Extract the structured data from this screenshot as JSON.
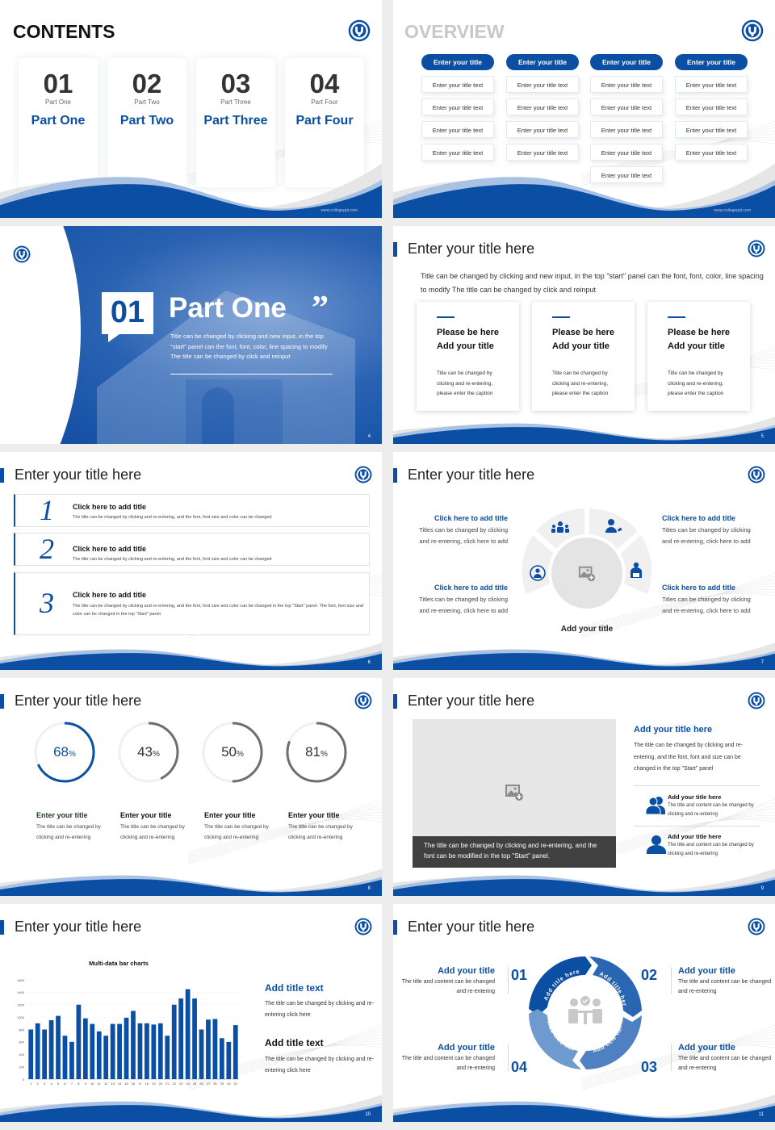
{
  "theme": {
    "brand_blue": "#0a4fa3",
    "light_blue": "#a9c1e3",
    "gray_text": "#333333",
    "ring_gray": "#6e6e6e"
  },
  "footer": {
    "url": "www.collegeppt.com"
  },
  "slides": {
    "contents": {
      "title": "CONTENTS",
      "cards": [
        {
          "num": "01",
          "sub": "Part One",
          "name": "Part One"
        },
        {
          "num": "02",
          "sub": "Part Two",
          "name": "Part Two"
        },
        {
          "num": "03",
          "sub": "Part Three",
          "name": "Part Three"
        },
        {
          "num": "04",
          "sub": "Part Four",
          "name": "Part Four"
        }
      ]
    },
    "overview": {
      "title": "OVERVIEW",
      "columns": [
        {
          "head": "Enter your title",
          "items": [
            "Enter your title text",
            "Enter your title text",
            "Enter your title text",
            "Enter your title text"
          ]
        },
        {
          "head": "Enter your title",
          "items": [
            "Enter your title text",
            "Enter your title text",
            "Enter your title text",
            "Enter your title text"
          ]
        },
        {
          "head": "Enter your title",
          "items": [
            "Enter your title text",
            "Enter your title text",
            "Enter your title text",
            "Enter your title text",
            "Enter your title text"
          ]
        },
        {
          "head": "Enter your title",
          "items": [
            "Enter your title text",
            "Enter your title text",
            "Enter your title text",
            "Enter your title text"
          ]
        }
      ]
    },
    "part_one": {
      "num": "01",
      "title": "Part One",
      "quote": "”",
      "desc": "Title can be changed by clicking and new input, in the top \"start\" panel can the font, font, color, line spacing to modify The title can be changed by click and reinput",
      "page": "4"
    },
    "s5": {
      "title": "Enter your title here",
      "desc": "Title can be changed by clicking and new input, in the top \"start\" panel can the font, font, color, line spacing to modify The title can be changed by click and reinput",
      "cards": [
        {
          "h1": "Please be here",
          "h2": "Add your title",
          "p": "Title can be changed by clicking and re-entering, please enter the caption"
        },
        {
          "h1": "Please be here",
          "h2": "Add your title",
          "p": "Title can be changed by clicking and re-entering, please enter the caption"
        },
        {
          "h1": "Please be here",
          "h2": "Add your title",
          "p": "Title can be changed by clicking and re-entering, please enter the caption"
        }
      ],
      "page": "5"
    },
    "s6": {
      "title": "Enter your title here",
      "rows": [
        {
          "num": "1",
          "h": "Click here to add title",
          "p": "The title can be changed by clicking and re-entering, and the font, font size and color can be changed"
        },
        {
          "num": "2",
          "h": "Click here to add title",
          "p": "The title can be changed by clicking and re-entering, and the font, font size and color can be changed"
        },
        {
          "num": "3",
          "h": "Click here to add title",
          "p": "The title can be changed by clicking and re-entering, and the font, font size and color can be changed in the top \"Start\" panel. The font, font size and color can be changed in the top \"Start\" panel."
        }
      ],
      "page": "6"
    },
    "s7": {
      "title": "Enter your title here",
      "blocks": [
        {
          "h": "Click here to add title",
          "p": "Titles can be changed by clicking and re-entering, click here to add"
        },
        {
          "h": "Click here to add title",
          "p": "Titles can be changed by clicking and re-entering, click here to add"
        },
        {
          "h": "Click here to add title",
          "p": "Titles can be changed by clicking and re-entering, click here to add"
        },
        {
          "h": "Click here to add title",
          "p": "Titles can be changed by clicking and re-entering, click here to add"
        }
      ],
      "center_title": "Add your title",
      "icons": [
        "team-icon",
        "person-edit-icon",
        "person-cycle-icon",
        "reader-icon",
        "image-add-icon"
      ],
      "page": "7"
    },
    "s8": {
      "title": "Enter your title here",
      "rings": [
        {
          "value": 68,
          "label": "68",
          "h": "Enter your title",
          "p": "The title can be changed by clicking and re-entering",
          "highlight": true
        },
        {
          "value": 43,
          "label": "43",
          "h": "Enter your title",
          "p": "The title can be changed by clicking and re-entering",
          "highlight": false
        },
        {
          "value": 50,
          "label": "50",
          "h": "Enter your title",
          "p": "The title can be changed by clicking and re-entering",
          "highlight": false
        },
        {
          "value": 81,
          "label": "81",
          "h": "Enter your title",
          "p": "The title can be changed by clicking and re-entering",
          "highlight": false
        }
      ],
      "pct_sign": "%",
      "page": "8"
    },
    "s9": {
      "title": "Enter your title here",
      "caption": "The title can be changed by clicking and re-entering, and the font can be modified in the top \"Start\" panel.",
      "h": "Add your title here",
      "p": "The title can be changed by clicking and re-entering, and the font, font and size can be changed in the top \"Start\" panel",
      "items": [
        {
          "h": "Add your title here",
          "p": "The title and content can be changed by clicking and re-entering"
        },
        {
          "h": "Add your title here",
          "p": "The title and content can be changed by clicking and re-entering"
        }
      ],
      "page": "9"
    },
    "s10": {
      "title": "Enter your title here",
      "blocks": [
        {
          "h": "Add title text",
          "p": "The title can be changed by clicking and re-entering click here"
        },
        {
          "h": "Add title text",
          "p": "The title can be changed by clicking and re-entering click here"
        }
      ],
      "page": "10"
    },
    "s11": {
      "title": "Enter your title here",
      "blocks": [
        {
          "num": "01",
          "h": "Add your title",
          "p": "The title and content can be changed and re-entering"
        },
        {
          "num": "02",
          "h": "Add your title",
          "p": "The title and content can be changed and re-entering"
        },
        {
          "num": "03",
          "h": "Add your title",
          "p": "The title and content can be changed and re-entering"
        },
        {
          "num": "04",
          "h": "Add your title",
          "p": "The title and content can be changed and re-entering"
        }
      ],
      "segments": [
        "Add title here",
        "Add title here",
        "Add title here",
        "Add title here"
      ],
      "page": "11"
    }
  },
  "chart_data": {
    "type": "bar",
    "title": "Multi-data bar charts",
    "xlabel": "",
    "ylabel": "",
    "categories": [
      "1",
      "2",
      "3",
      "4",
      "5",
      "6",
      "7",
      "8",
      "9",
      "10",
      "11",
      "12",
      "13",
      "14",
      "15",
      "16",
      "17",
      "18",
      "19",
      "20",
      "21",
      "22",
      "23",
      "24",
      "25",
      "26",
      "27",
      "28",
      "29",
      "30",
      "31"
    ],
    "values": [
      800,
      900,
      800,
      950,
      1020,
      700,
      600,
      1200,
      980,
      890,
      770,
      700,
      890,
      890,
      990,
      1100,
      900,
      900,
      880,
      900,
      700,
      1200,
      1300,
      1450,
      1300,
      800,
      960,
      970,
      660,
      600,
      870
    ],
    "yticks": [
      0,
      200,
      400,
      600,
      800,
      1000,
      1200,
      1400,
      1600
    ],
    "ylim": [
      0,
      1600
    ],
    "grid": true,
    "legend": "none",
    "color": "#0a4fa3"
  }
}
